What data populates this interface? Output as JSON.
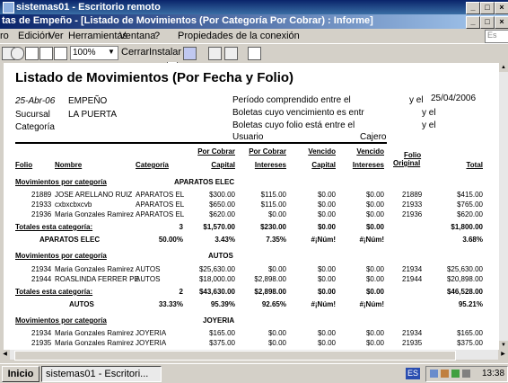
{
  "outer_window": {
    "title": "sistemas01 - Escritorio remoto"
  },
  "inner_window": {
    "title": "tas de Empeño - [Listado de Movimientos (Por Categoría Por Cobrar) : Informe]"
  },
  "menu": [
    "ro",
    "Edición",
    "Ver",
    "Herramientas",
    "Ventana",
    "?",
    "Propiedades de la conexión"
  ],
  "menu_help_box": "Es",
  "toolbar": {
    "zoom": "100%",
    "close_label": "Cerrar",
    "install_label": "Instalar"
  },
  "report": {
    "title": "Listado de Movimientos (Por Fecha y Folio)",
    "date": "25-Abr-06",
    "company": "EMPEÑO",
    "branch_label": "Sucursal",
    "branch": "LA PUERTA",
    "category_label": "Categoría",
    "period_label": "Período comprendido entre el",
    "y_el_1": "y el",
    "period_end": "25/04/2006",
    "due_label": "Boletas cuyo vencimiento es entr",
    "y_el_2": "y el",
    "folio_label": "Boletas cuyo folio está entre el",
    "y_el_3": "y el",
    "user_label": "Usuario",
    "cashier_label": "Cajero",
    "headers": {
      "folio": "Folio",
      "nombre": "Nombre",
      "categoria": "Categoría",
      "pc_top": "Por Cobrar",
      "pc_bottom": "Capital",
      "pi_top": "Por Cobrar",
      "pi_bottom": "Intereses",
      "vc_top": "Vencido",
      "vc_bottom": "Capital",
      "vi_top": "Vencido",
      "vi_bottom": "Intereses",
      "fo_top": "Folio",
      "fo_bottom": "Original",
      "total": "Total"
    },
    "groups": [
      {
        "label": "Movimientos por categoría",
        "name": "APARATOS ELEC",
        "rows": [
          {
            "folio": "21889",
            "nombre": "JOSE ARELLANO RUIZ",
            "cat": "APARATOS EL",
            "pc": "$300.00",
            "pi": "$115.00",
            "vc": "$0.00",
            "vi": "$0.00",
            "fo": "21889",
            "total": "$415.00"
          },
          {
            "folio": "21933",
            "nombre": "cxbxcbxcvb",
            "cat": "APARATOS EL",
            "pc": "$650.00",
            "pi": "$115.00",
            "vc": "$0.00",
            "vi": "$0.00",
            "fo": "21933",
            "total": "$765.00"
          },
          {
            "folio": "21936",
            "nombre": "Maria Gonzales Ramirez",
            "cat": "APARATOS EL",
            "pc": "$620.00",
            "pi": "$0.00",
            "vc": "$0.00",
            "vi": "$0.00",
            "fo": "21936",
            "total": "$620.00"
          }
        ],
        "totals": {
          "label": "Totales esta categoría:",
          "count": "3",
          "pc": "$1,570.00",
          "pi": "$230.00",
          "vc": "$0.00",
          "vi": "$0.00",
          "total": "$1,800.00"
        },
        "pct": {
          "name": "APARATOS ELEC",
          "count": "50.00%",
          "pc": "3.43%",
          "pi": "7.35%",
          "vc": "#¡Núm!",
          "vi": "#¡Núm!",
          "total": "3.68%"
        }
      },
      {
        "label": "Movimientos por categoría",
        "name": "AUTOS",
        "rows": [
          {
            "folio": "21934",
            "nombre": "Maria Gonzales Ramirez",
            "cat": "AUTOS",
            "pc": "$25,630.00",
            "pi": "$0.00",
            "vc": "$0.00",
            "vi": "$0.00",
            "fo": "21934",
            "total": "$25,630.00"
          },
          {
            "folio": "21944",
            "nombre": "ROASLINDA FERRER PE",
            "cat": "AUTOS",
            "pc": "$18,000.00",
            "pi": "$2,898.00",
            "vc": "$0.00",
            "vi": "$0.00",
            "fo": "21944",
            "total": "$20,898.00"
          }
        ],
        "totals": {
          "label": "Totales esta categoría:",
          "count": "2",
          "pc": "$43,630.00",
          "pi": "$2,898.00",
          "vc": "$0.00",
          "vi": "$0.00",
          "total": "$46,528.00"
        },
        "pct": {
          "name": "AUTOS",
          "count": "33.33%",
          "pc": "95.39%",
          "pi": "92.65%",
          "vc": "#¡Núm!",
          "vi": "#¡Núm!",
          "total": "95.21%"
        }
      },
      {
        "label": "Movimientos por categoría",
        "name": "JOYERIA",
        "rows": [
          {
            "folio": "21934",
            "nombre": "Maria Gonzales Ramirez",
            "cat": "JOYERIA",
            "pc": "$165.00",
            "pi": "$0.00",
            "vc": "$0.00",
            "vi": "$0.00",
            "fo": "21934",
            "total": "$165.00"
          },
          {
            "folio": "21935",
            "nombre": "Maria Gonzales Ramirez",
            "cat": "JOYERIA",
            "pc": "$375.00",
            "pi": "$0.00",
            "vc": "$0.00",
            "vi": "$0.00",
            "fo": "21935",
            "total": "$375.00"
          }
        ]
      }
    ]
  },
  "taskbar": {
    "start": "Inicio",
    "task": "sistemas01 - Escritori...",
    "lang": "ES",
    "time": "13:38"
  }
}
